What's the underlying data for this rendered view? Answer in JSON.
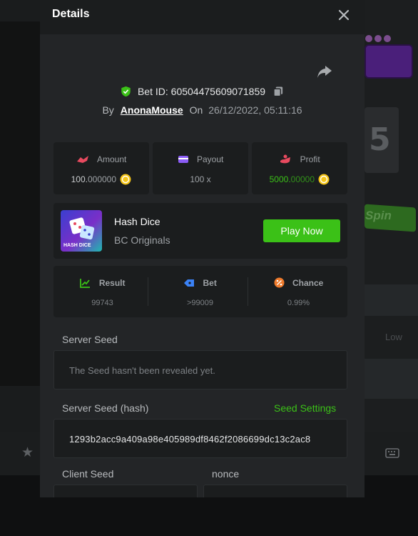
{
  "colors": {
    "accent_green": "#3bc117",
    "modal_bg": "#232527",
    "card_bg": "#1b1d1e",
    "coin": "#f5c518"
  },
  "background": {
    "spin_label": "Spin",
    "reel_number": "5",
    "low_label": "Low",
    "icons": [
      "star-icon",
      "keyboard-icon"
    ]
  },
  "modal": {
    "title": "Details",
    "close_icon": "close-icon",
    "share_icon": "share-icon",
    "bet_id_label": "Bet ID: 60504475609071859",
    "by_label": "By",
    "username": "AnonaMouse",
    "on_label": "On",
    "date": "26/12/2022, 05:11:16",
    "stats": {
      "amount": {
        "label": "Amount",
        "value_main": "100.",
        "value_dim": "000000",
        "icon": "coin-icon"
      },
      "payout": {
        "label": "Payout",
        "value": "100 x"
      },
      "profit": {
        "label": "Profit",
        "value_main": "5000.",
        "value_dim": "00000",
        "icon": "coin-icon"
      }
    },
    "game": {
      "thumb_label": "HASH DICE",
      "name": "Hash Dice",
      "category": "BC Originals",
      "play_button": "Play Now"
    },
    "result": {
      "result_label": "Result",
      "result_value": "99743",
      "bet_label": "Bet",
      "bet_value": ">99009",
      "chance_label": "Chance",
      "chance_value": "0.99%"
    },
    "server_seed": {
      "label": "Server Seed",
      "value": "The Seed hasn't been revealed yet."
    },
    "server_seed_hash": {
      "label": "Server Seed (hash)",
      "settings_link": "Seed Settings",
      "value": "1293b2acc9a409a98e405989df8462f2086699dc13c2ac8"
    },
    "client_seed": {
      "label": "Client Seed"
    },
    "nonce": {
      "label": "nonce"
    }
  }
}
